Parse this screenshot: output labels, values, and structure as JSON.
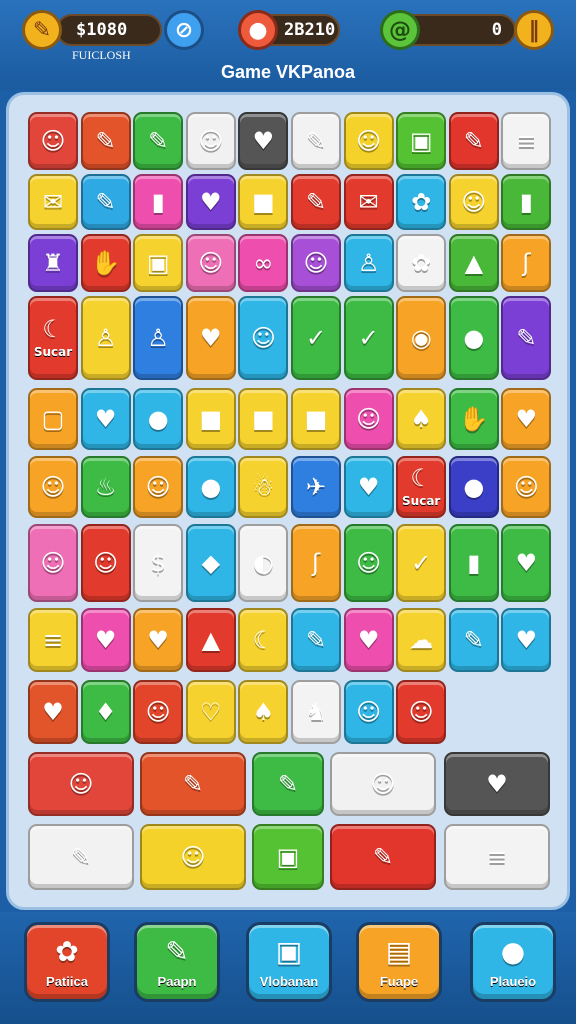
{
  "hud": {
    "left": {
      "value": "$1080",
      "sub": "FUICLOSH",
      "icon": "spear-icon"
    },
    "center": {
      "value": "2B210",
      "icon": "location-pin-icon"
    },
    "right": {
      "value": "0",
      "icon": "lime-swirl-icon",
      "action": "pause-icon"
    },
    "title": "Game VKPanoa"
  },
  "board": {
    "tiles": [
      {
        "g": "☺",
        "lbl": "",
        "name": "face-icon",
        "c": "#e2453a"
      },
      {
        "g": "✎",
        "lbl": "",
        "name": "carrot-icon",
        "c": "#e3542a"
      },
      {
        "g": "✎",
        "lbl": "",
        "name": "pen-icon",
        "c": "#3dbb44"
      },
      {
        "g": "☺",
        "lbl": "",
        "name": "chef-face-icon",
        "c": "#f1f1f1"
      },
      {
        "g": "♥",
        "lbl": "",
        "name": "heart-icon",
        "c": "#555555"
      },
      {
        "g": "✎",
        "lbl": "",
        "name": "pencil-icon",
        "c": "#f2f2f2"
      },
      {
        "g": "☺",
        "lbl": "",
        "name": "face-icon",
        "c": "#f5d22a"
      },
      {
        "g": "▣",
        "lbl": "",
        "name": "gift-icon",
        "c": "#54c232"
      },
      {
        "g": "✎",
        "lbl": "",
        "name": "carrot-icon",
        "c": "#e2352c"
      },
      {
        "g": "≡",
        "lbl": "",
        "name": "stripes-icon",
        "c": "#f3f3f3"
      },
      {
        "g": "✉",
        "lbl": "",
        "name": "note-icon",
        "c": "#f6d22e"
      },
      {
        "g": "✎",
        "lbl": "",
        "name": "pencil-icon",
        "c": "#2fa9e3"
      },
      {
        "g": "▮",
        "lbl": "",
        "name": "battery-icon",
        "c": "#ee4fae"
      },
      {
        "g": "♥",
        "lbl": "",
        "name": "heart-icon",
        "c": "#7b3fd6"
      },
      {
        "g": "■",
        "lbl": "",
        "name": "box-icon",
        "c": "#f6d22e"
      },
      {
        "g": "✎",
        "lbl": "",
        "name": "carrot-icon",
        "c": "#e23a2c"
      },
      {
        "g": "✉",
        "lbl": "",
        "name": "bow-icon",
        "c": "#e23a2c"
      },
      {
        "g": "✿",
        "lbl": "",
        "name": "flower-icon",
        "c": "#2fb6e6"
      },
      {
        "g": "☺",
        "lbl": "",
        "name": "face-icon",
        "c": "#f6d22e"
      },
      {
        "g": "▮",
        "lbl": "",
        "name": "block-icon",
        "c": "#49b838"
      },
      {
        "g": "♜",
        "lbl": "",
        "name": "robot-icon",
        "c": "#7b3fd6"
      },
      {
        "g": "✋",
        "lbl": "",
        "name": "hand-icon",
        "c": "#e23a2c"
      },
      {
        "g": "▣",
        "lbl": "",
        "name": "house-icon",
        "c": "#f6d22e"
      },
      {
        "g": "☺",
        "lbl": "",
        "name": "face-icon",
        "c": "#ef6fb6"
      },
      {
        "g": "∞",
        "lbl": "",
        "name": "squiggle-icon",
        "c": "#ee4fae"
      },
      {
        "g": "☺",
        "lbl": "",
        "name": "face-icon",
        "c": "#a74fd6"
      },
      {
        "g": "♙",
        "lbl": "",
        "name": "figure-icon",
        "c": "#2fb6e6"
      },
      {
        "g": "✿",
        "lbl": "",
        "name": "balloon-icon",
        "c": "#f3f3f3"
      },
      {
        "g": "▲",
        "lbl": "",
        "name": "cone-icon",
        "c": "#49b838"
      },
      {
        "g": "ʃ",
        "lbl": "",
        "name": "hook-icon",
        "c": "#f6a326"
      },
      {
        "g": "☾",
        "lbl": "Sucar",
        "name": "banana-icon",
        "c": "#e23a2c"
      },
      {
        "g": "♙",
        "lbl": "",
        "name": "figure-icon",
        "c": "#f6d22e"
      },
      {
        "g": "♙",
        "lbl": "",
        "name": "figure-icon",
        "c": "#2f7fe0"
      },
      {
        "g": "♥",
        "lbl": "",
        "name": "apple-icon",
        "c": "#f6a326"
      },
      {
        "g": "☺",
        "lbl": "",
        "name": "face-icon",
        "c": "#2fb6e6"
      },
      {
        "g": "✓",
        "lbl": "",
        "name": "check-icon",
        "c": "#3dbb44"
      },
      {
        "g": "✓",
        "lbl": "",
        "name": "check-icon",
        "c": "#3dbb44"
      },
      {
        "g": "◉",
        "lbl": "",
        "name": "pot-icon",
        "c": "#f6a326"
      },
      {
        "g": "●",
        "lbl": "",
        "name": "apple-icon",
        "c": "#3dbb44"
      },
      {
        "g": "✎",
        "lbl": "",
        "name": "brush-icon",
        "c": "#7b3fd6"
      },
      {
        "g": "▢",
        "lbl": "",
        "name": "bag-icon",
        "c": "#f6a326"
      },
      {
        "g": "♥",
        "lbl": "",
        "name": "heart-icon",
        "c": "#2fb6e6"
      },
      {
        "g": "●",
        "lbl": "",
        "name": "apple-icon",
        "c": "#2fb6e6"
      },
      {
        "g": "■",
        "lbl": "",
        "name": "box-icon",
        "c": "#f6d22e"
      },
      {
        "g": "■",
        "lbl": "",
        "name": "box-icon",
        "c": "#f6d22e"
      },
      {
        "g": "■",
        "lbl": "",
        "name": "box-icon",
        "c": "#f6d22e"
      },
      {
        "g": "☺",
        "lbl": "",
        "name": "face-icon",
        "c": "#ee4fae"
      },
      {
        "g": "♠",
        "lbl": "",
        "name": "tree-icon",
        "c": "#f6d22e"
      },
      {
        "g": "✋",
        "lbl": "",
        "name": "hand-icon",
        "c": "#3dbb44"
      },
      {
        "g": "♥",
        "lbl": "",
        "name": "heart-icon",
        "c": "#f6a326"
      },
      {
        "g": "☺",
        "lbl": "",
        "name": "face-icon",
        "c": "#f6a326"
      },
      {
        "g": "♨",
        "lbl": "",
        "name": "cup-icon",
        "c": "#3dbb44"
      },
      {
        "g": "☺",
        "lbl": "",
        "name": "face-icon",
        "c": "#f6a326"
      },
      {
        "g": "●",
        "lbl": "",
        "name": "apple-icon",
        "c": "#2fb6e6"
      },
      {
        "g": "☃",
        "lbl": "",
        "name": "ghost-icon",
        "c": "#f6d22e"
      },
      {
        "g": "✈",
        "lbl": "",
        "name": "bird-icon",
        "c": "#2f7fe0"
      },
      {
        "g": "♥",
        "lbl": "",
        "name": "heart-icon",
        "c": "#2fb6e6"
      },
      {
        "g": "☾",
        "lbl": "Sucar",
        "name": "banana-icon",
        "c": "#e23a2c"
      },
      {
        "g": "●",
        "lbl": "",
        "name": "ball-icon",
        "c": "#3b3fc8"
      },
      {
        "g": "☺",
        "lbl": "",
        "name": "face-icon",
        "c": "#f6a326"
      },
      {
        "g": "☺",
        "lbl": "",
        "name": "face-icon",
        "c": "#ef6fb6"
      },
      {
        "g": "☺",
        "lbl": "",
        "name": "face-icon",
        "c": "#e23a2c"
      },
      {
        "g": "$",
        "lbl": "",
        "name": "dollar-icon",
        "c": "#f3f3f3"
      },
      {
        "g": "◆",
        "lbl": "",
        "name": "diamond-icon",
        "c": "#2fb6e6"
      },
      {
        "g": "◐",
        "lbl": "",
        "name": "leaf-icon",
        "c": "#f3f3f3"
      },
      {
        "g": "ʃ",
        "lbl": "",
        "name": "hook-icon",
        "c": "#f6a326"
      },
      {
        "g": "☺",
        "lbl": "",
        "name": "face-icon",
        "c": "#3dbb44"
      },
      {
        "g": "✓",
        "lbl": "",
        "name": "check-icon",
        "c": "#f6d22e"
      },
      {
        "g": "▮",
        "lbl": "",
        "name": "popsicle-icon",
        "c": "#3dbb44"
      },
      {
        "g": "♥",
        "lbl": "",
        "name": "heart-icon",
        "c": "#3dbb44"
      },
      {
        "g": "≡",
        "lbl": "",
        "name": "stripes-icon",
        "c": "#f6d22e"
      },
      {
        "g": "♥",
        "lbl": "",
        "name": "heart-icon",
        "c": "#ee4fae"
      },
      {
        "g": "♥",
        "lbl": "",
        "name": "heart-icon",
        "c": "#f6a326"
      },
      {
        "g": "▲",
        "lbl": "",
        "name": "cone-icon",
        "c": "#e23a2c"
      },
      {
        "g": "☾",
        "lbl": "",
        "name": "banana-icon",
        "c": "#f6d22e"
      },
      {
        "g": "✎",
        "lbl": "",
        "name": "key-icon",
        "c": "#2fb6e6"
      },
      {
        "g": "♥",
        "lbl": "",
        "name": "heart-icon",
        "c": "#ee4fae"
      },
      {
        "g": "☁",
        "lbl": "",
        "name": "cloud-icon",
        "c": "#f6d22e"
      },
      {
        "g": "✎",
        "lbl": "",
        "name": "pen-icon",
        "c": "#2fb6e6"
      },
      {
        "g": "♥",
        "lbl": "",
        "name": "heart-icon",
        "c": "#2fb6e6"
      },
      {
        "g": "♥",
        "lbl": "",
        "name": "heart-icon",
        "c": "#e2542a"
      },
      {
        "g": "♦",
        "lbl": "",
        "name": "drop-icon",
        "c": "#3dbb44"
      },
      {
        "g": "☺",
        "lbl": "",
        "name": "cat-icon",
        "c": "#e2452a"
      },
      {
        "g": "♡",
        "lbl": "",
        "name": "heart-outline-icon",
        "c": "#f6d22e"
      },
      {
        "g": "♠",
        "lbl": "",
        "name": "drop-icon",
        "c": "#f6d22e"
      },
      {
        "g": "♞",
        "lbl": "",
        "name": "cart-icon",
        "c": "#f3f3f3"
      },
      {
        "g": "☺",
        "lbl": "",
        "name": "bear-icon",
        "c": "#2fb6e6"
      },
      {
        "g": "☺",
        "lbl": "",
        "name": "face-icon",
        "c": "#e23a2c"
      }
    ]
  },
  "buttons": [
    {
      "label": "Patiica",
      "icon": "flower-icon",
      "color": "#e2452a"
    },
    {
      "label": "Paapn",
      "icon": "axe-icon",
      "color": "#3dbb44"
    },
    {
      "label": "Vlobanan",
      "icon": "card-icon",
      "color": "#2fb6e6"
    },
    {
      "label": "Fuape",
      "icon": "monitor-icon",
      "color": "#f6a326"
    },
    {
      "label": "Plaueio",
      "icon": "chat-icon",
      "color": "#2fb6e6"
    }
  ]
}
